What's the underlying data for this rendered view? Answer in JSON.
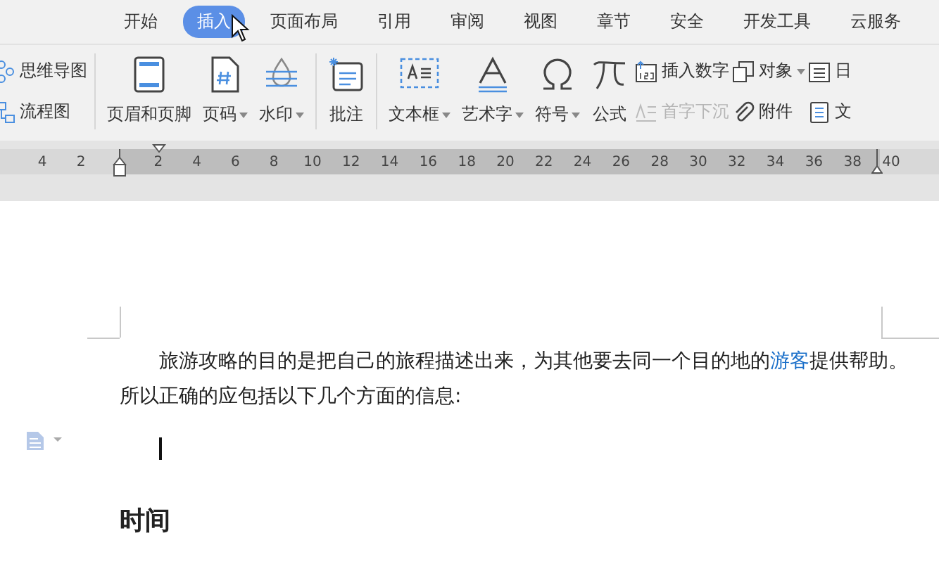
{
  "tabs": [
    {
      "label": "开始",
      "selected": false
    },
    {
      "label": "插入",
      "selected": true
    },
    {
      "label": "页面布局",
      "selected": false
    },
    {
      "label": "引用",
      "selected": false
    },
    {
      "label": "审阅",
      "selected": false
    },
    {
      "label": "视图",
      "selected": false
    },
    {
      "label": "章节",
      "selected": false
    },
    {
      "label": "安全",
      "selected": false
    },
    {
      "label": "开发工具",
      "selected": false
    },
    {
      "label": "云服务",
      "selected": false
    }
  ],
  "ribbon": {
    "groups": [
      {
        "columns": [
          [
            {
              "label": "思维导图",
              "disabled": false,
              "dropdown": false
            },
            {
              "label": "流程图",
              "disabled": false,
              "dropdown": false
            }
          ]
        ]
      },
      {
        "large": [
          {
            "label": "页眉和页脚",
            "dropdown": false
          },
          {
            "label": "页码",
            "dropdown": true
          },
          {
            "label": "水印",
            "dropdown": true
          }
        ]
      },
      {
        "large": [
          {
            "label": "批注",
            "dropdown": false
          }
        ]
      },
      {
        "large": [
          {
            "label": "文本框",
            "dropdown": true
          },
          {
            "label": "艺术字",
            "dropdown": true
          },
          {
            "label": "符号",
            "dropdown": true
          },
          {
            "label": "公式",
            "dropdown": false
          }
        ],
        "columns": [
          [
            {
              "label": "插入数字",
              "disabled": false,
              "dropdown": false
            },
            {
              "label": "首字下沉",
              "disabled": true,
              "dropdown": false
            }
          ],
          [
            {
              "label": "对象",
              "disabled": false,
              "dropdown": true
            },
            {
              "label": "附件",
              "disabled": false,
              "dropdown": false
            }
          ],
          [
            {
              "label": "日",
              "disabled": false,
              "dropdown": false
            },
            {
              "label": "文",
              "disabled": false,
              "dropdown": false
            }
          ]
        ]
      }
    ]
  },
  "ruler": {
    "left_labels": [
      "4",
      "2"
    ],
    "right_labels": [
      "2",
      "4",
      "6",
      "8",
      "10",
      "12",
      "14",
      "16",
      "18",
      "20",
      "22",
      "24",
      "26",
      "28",
      "30",
      "32",
      "34",
      "36",
      "38",
      "40"
    ]
  },
  "document": {
    "paragraph": [
      {
        "kind": "plain",
        "text": "旅游攻略的目的是把自己的旅程描述出来，为其他要去同一个目的地的"
      },
      {
        "kind": "link",
        "text": "游客"
      },
      {
        "kind": "plain",
        "text": "提供帮助。所以正确的应包括以下几个方面的信息:"
      }
    ],
    "heading": "时间"
  }
}
